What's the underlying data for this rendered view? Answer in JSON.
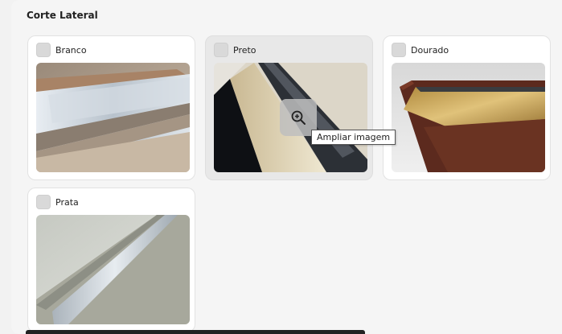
{
  "section": {
    "title": "Corte Lateral"
  },
  "options": [
    {
      "label": "Branco"
    },
    {
      "label": "Preto"
    },
    {
      "label": "Dourado"
    },
    {
      "label": "Prata"
    }
  ],
  "tooltip": {
    "text": "Ampliar imagem"
  },
  "icons": {
    "zoom": "zoom-in-icon",
    "checkbox": "checkbox-icon"
  }
}
